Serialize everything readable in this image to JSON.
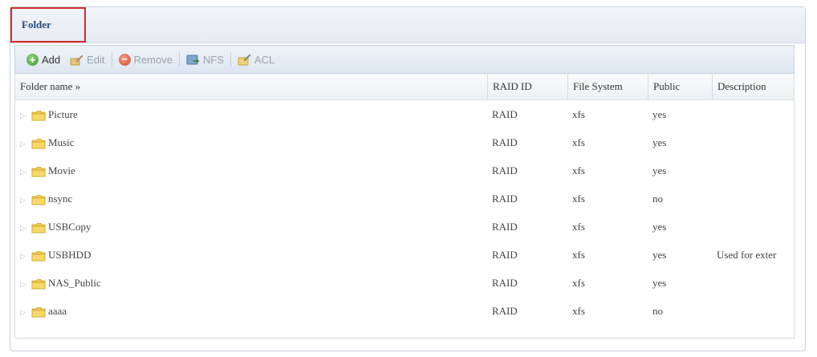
{
  "panel": {
    "title": "Folder"
  },
  "toolbar": {
    "add": "Add",
    "edit": "Edit",
    "remove": "Remove",
    "nfs": "NFS",
    "acl": "ACL"
  },
  "columns": {
    "name": "Folder name »",
    "raid": "RAID ID",
    "fs": "File System",
    "public": "Public",
    "description": "Description"
  },
  "rows": [
    {
      "name": "Picture",
      "raid": "RAID",
      "fs": "xfs",
      "public": "yes",
      "description": ""
    },
    {
      "name": "Music",
      "raid": "RAID",
      "fs": "xfs",
      "public": "yes",
      "description": ""
    },
    {
      "name": "Movie",
      "raid": "RAID",
      "fs": "xfs",
      "public": "yes",
      "description": ""
    },
    {
      "name": "nsync",
      "raid": "RAID",
      "fs": "xfs",
      "public": "no",
      "description": ""
    },
    {
      "name": "USBCopy",
      "raid": "RAID",
      "fs": "xfs",
      "public": "yes",
      "description": ""
    },
    {
      "name": "USBHDD",
      "raid": "RAID",
      "fs": "xfs",
      "public": "yes",
      "description": "Used for exter"
    },
    {
      "name": "NAS_Public",
      "raid": "RAID",
      "fs": "xfs",
      "public": "yes",
      "description": ""
    },
    {
      "name": "aaaa",
      "raid": "RAID",
      "fs": "xfs",
      "public": "no",
      "description": ""
    }
  ],
  "icons": {
    "add": "add-icon",
    "edit": "edit-icon",
    "remove": "remove-icon",
    "nfs": "nfs-icon",
    "acl": "acl-icon",
    "folder": "folder-icon",
    "expander": "expand-arrow-icon"
  },
  "colors": {
    "title_highlight": "#d62b2b",
    "folder": "#f2c94c"
  }
}
